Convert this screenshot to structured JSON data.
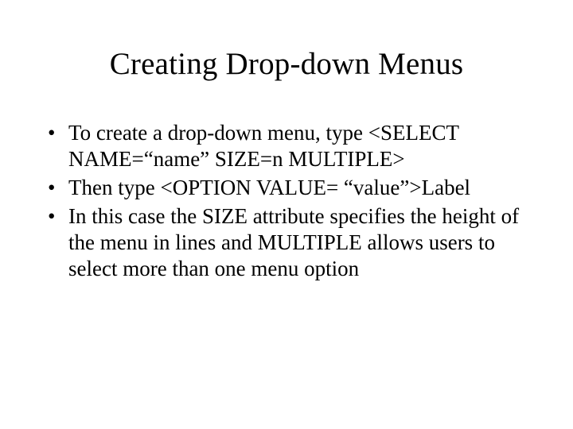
{
  "slide": {
    "title": "Creating Drop-down Menus",
    "bullets": [
      "To create a drop-down menu, type <SELECT NAME=“name” SIZE=n MULTIPLE>",
      "Then type <OPTION VALUE= “value”>Label",
      "In this case the SIZE attribute specifies the height of the menu in lines and MULTIPLE allows users to select more than one menu option"
    ]
  }
}
